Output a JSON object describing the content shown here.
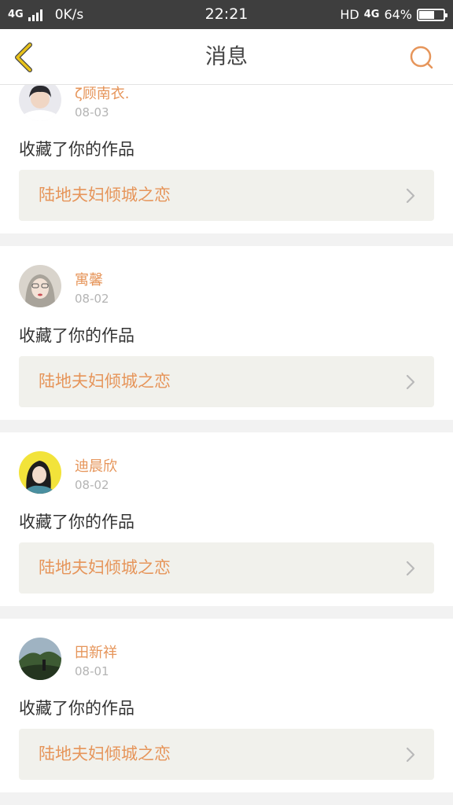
{
  "status_bar": {
    "network": "4G",
    "speed": "0K/s",
    "time": "22:21",
    "hd": "HD",
    "network_right": "4G",
    "battery": "64%",
    "battery_level": 0.64
  },
  "header": {
    "title": "消息"
  },
  "colors": {
    "accent": "#e6955a",
    "back_arrow": "#e8c21a",
    "work_box_bg": "#f1f1ec"
  },
  "messages": [
    {
      "user": "ζ顾南衣.",
      "date": "08-03",
      "action": "收藏了你的作品",
      "work": "陆地夫妇倾城之恋",
      "avatar": "avatar-boy"
    },
    {
      "user": "寓馨",
      "date": "08-02",
      "action": "收藏了你的作品",
      "work": "陆地夫妇倾城之恋",
      "avatar": "avatar-girl"
    },
    {
      "user": "迪晨欣",
      "date": "08-02",
      "action": "收藏了你的作品",
      "work": "陆地夫妇倾城之恋",
      "avatar": "avatar-woman-yellow"
    },
    {
      "user": "田新祥",
      "date": "08-01",
      "action": "收藏了你的作品",
      "work": "陆地夫妇倾城之恋",
      "avatar": "avatar-landscape"
    }
  ]
}
